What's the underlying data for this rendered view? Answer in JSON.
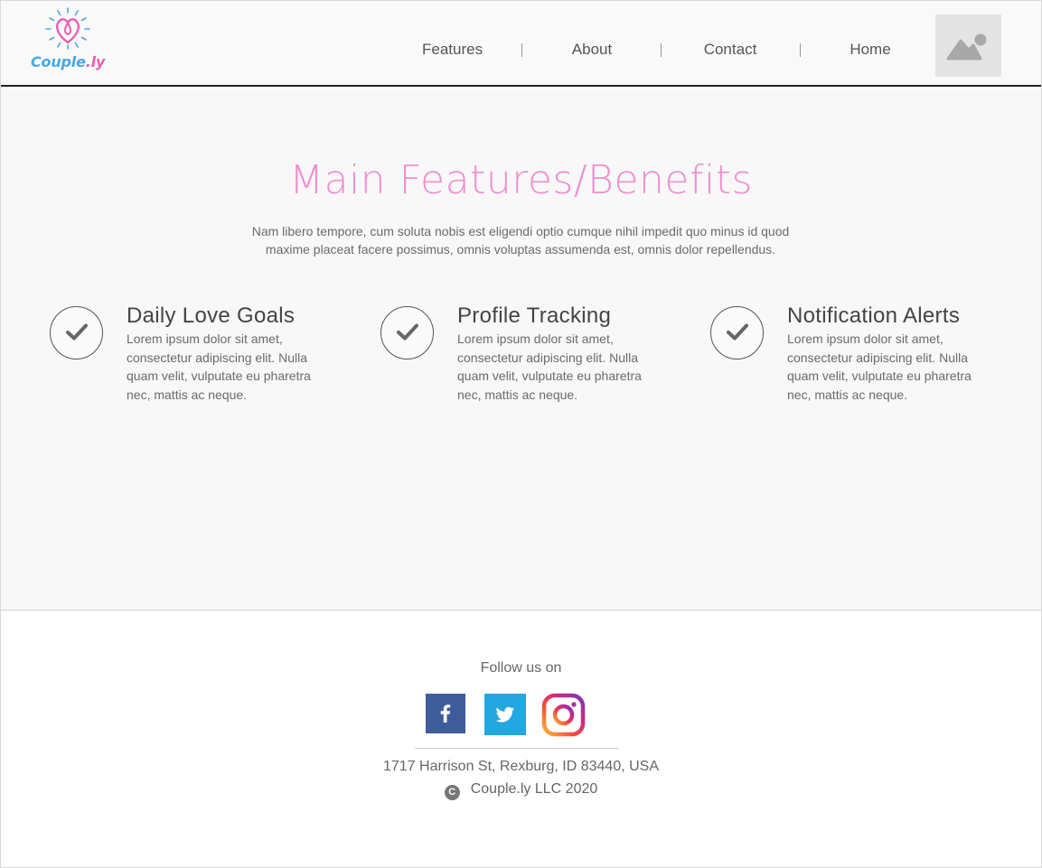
{
  "brand": {
    "name_part1": "Couple",
    "name_part2": ".ly",
    "colors": {
      "primary_pink": "#e85fb8",
      "primary_blue": "#4aa8e0",
      "title_pink": "#ef8fcf"
    }
  },
  "nav": {
    "items": [
      {
        "label": "Features"
      },
      {
        "label": "About"
      },
      {
        "label": "Contact"
      },
      {
        "label": "Home"
      }
    ],
    "separator": "|",
    "avatar_icon": "image-placeholder-icon"
  },
  "main": {
    "title": "Main Features/Benefits",
    "subtitle_line1": "Nam libero tempore, cum soluta nobis est eligendi optio cumque nihil impedit quo minus id quod",
    "subtitle_line2": "maxime placeat facere possimus, omnis voluptas assumenda est, omnis dolor repellendus.",
    "features": [
      {
        "title": "Daily Love Goals",
        "text": "Lorem ipsum dolor sit amet, consectetur adipiscing elit. Nulla quam velit, vulputate eu pharetra nec, mattis ac neque.",
        "icon": "check-circle-icon"
      },
      {
        "title": "Profile Tracking",
        "text": "Lorem ipsum dolor sit amet, consectetur adipiscing elit. Nulla quam velit, vulputate eu pharetra nec, mattis ac neque.",
        "icon": "check-circle-icon"
      },
      {
        "title": "Notification Alerts",
        "text": "Lorem ipsum dolor sit amet, consectetur adipiscing elit. Nulla quam velit, vulputate eu pharetra nec, mattis ac neque.",
        "icon": "check-circle-icon"
      }
    ]
  },
  "footer": {
    "follow_label": "Follow us on",
    "social": [
      {
        "name": "facebook",
        "icon": "facebook-icon",
        "color": "#3f5c9a"
      },
      {
        "name": "twitter",
        "icon": "twitter-icon",
        "color": "#24a7e0"
      },
      {
        "name": "instagram",
        "icon": "instagram-icon"
      }
    ],
    "address": "1717 Harrison St, Rexburg, ID 83440, USA",
    "copyright_symbol": "C",
    "copyright_text": "Couple.ly LLC 2020"
  }
}
